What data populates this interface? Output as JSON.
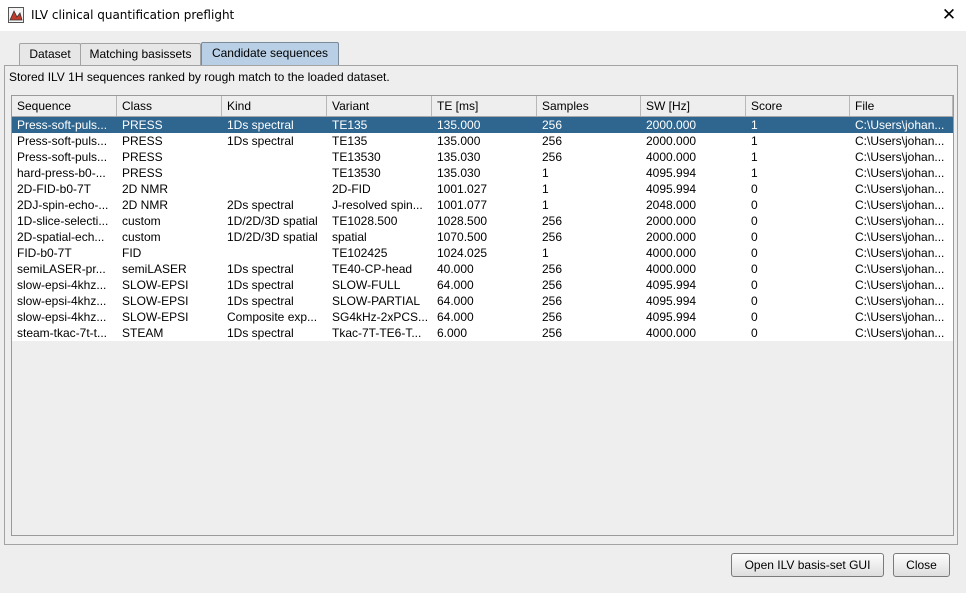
{
  "window": {
    "title": "ILV clinical quantification preflight",
    "close_glyph": "✕"
  },
  "tabs": [
    {
      "label": "Dataset",
      "active": false
    },
    {
      "label": "Matching basissets",
      "active": false
    },
    {
      "label": "Candidate sequences",
      "active": true
    }
  ],
  "description": "Stored ILV 1H sequences ranked by rough match to the loaded dataset.",
  "table": {
    "columns": [
      "Sequence",
      "Class",
      "Kind",
      "Variant",
      "TE [ms]",
      "Samples",
      "SW [Hz]",
      "Score",
      "File"
    ],
    "selected_row": 0,
    "rows": [
      [
        "Press-soft-puls...",
        "PRESS",
        "1Ds spectral",
        "TE135",
        "135.000",
        "256",
        "2000.000",
        "1",
        "C:\\Users\\johan..."
      ],
      [
        "Press-soft-puls...",
        "PRESS",
        "1Ds spectral",
        "TE135",
        "135.000",
        "256",
        "2000.000",
        "1",
        "C:\\Users\\johan..."
      ],
      [
        "Press-soft-puls...",
        "PRESS",
        "",
        "TE13530",
        "135.030",
        "256",
        "4000.000",
        "1",
        "C:\\Users\\johan..."
      ],
      [
        "hard-press-b0-...",
        "PRESS",
        "",
        "TE13530",
        "135.030",
        "1",
        "4095.994",
        "1",
        "C:\\Users\\johan..."
      ],
      [
        "2D-FID-b0-7T",
        "2D NMR",
        "",
        "2D-FID",
        "1001.027",
        "1",
        "4095.994",
        "0",
        "C:\\Users\\johan..."
      ],
      [
        "2DJ-spin-echo-...",
        "2D NMR",
        "2Ds spectral",
        "J-resolved spin...",
        "1001.077",
        "1",
        "2048.000",
        "0",
        "C:\\Users\\johan..."
      ],
      [
        "1D-slice-selecti...",
        "custom",
        "1D/2D/3D spatial",
        "TE1028.500",
        "1028.500",
        "256",
        "2000.000",
        "0",
        "C:\\Users\\johan..."
      ],
      [
        "2D-spatial-ech...",
        "custom",
        "1D/2D/3D spatial",
        "spatial",
        "1070.500",
        "256",
        "2000.000",
        "0",
        "C:\\Users\\johan..."
      ],
      [
        "FID-b0-7T",
        "FID",
        "",
        "TE102425",
        "1024.025",
        "1",
        "4000.000",
        "0",
        "C:\\Users\\johan..."
      ],
      [
        "semiLASER-pr...",
        "semiLASER",
        "1Ds spectral",
        "TE40-CP-head",
        "40.000",
        "256",
        "4000.000",
        "0",
        "C:\\Users\\johan..."
      ],
      [
        "slow-epsi-4khz...",
        "SLOW-EPSI",
        "1Ds spectral",
        "SLOW-FULL",
        "64.000",
        "256",
        "4095.994",
        "0",
        "C:\\Users\\johan..."
      ],
      [
        "slow-epsi-4khz...",
        "SLOW-EPSI",
        "1Ds spectral",
        "SLOW-PARTIAL",
        "64.000",
        "256",
        "4095.994",
        "0",
        "C:\\Users\\johan..."
      ],
      [
        "slow-epsi-4khz...",
        "SLOW-EPSI",
        "Composite exp...",
        "SG4kHz-2xPCS...",
        "64.000",
        "256",
        "4095.994",
        "0",
        "C:\\Users\\johan..."
      ],
      [
        "steam-tkac-7t-t...",
        "STEAM",
        "1Ds spectral",
        "Tkac-7T-TE6-T...",
        "6.000",
        "256",
        "4000.000",
        "0",
        "C:\\Users\\johan..."
      ]
    ]
  },
  "buttons": {
    "open_gui": "Open ILV basis-set GUI",
    "close": "Close"
  },
  "colors": {
    "selection": "#2f6690",
    "active_tab": "#b8cfe5"
  }
}
